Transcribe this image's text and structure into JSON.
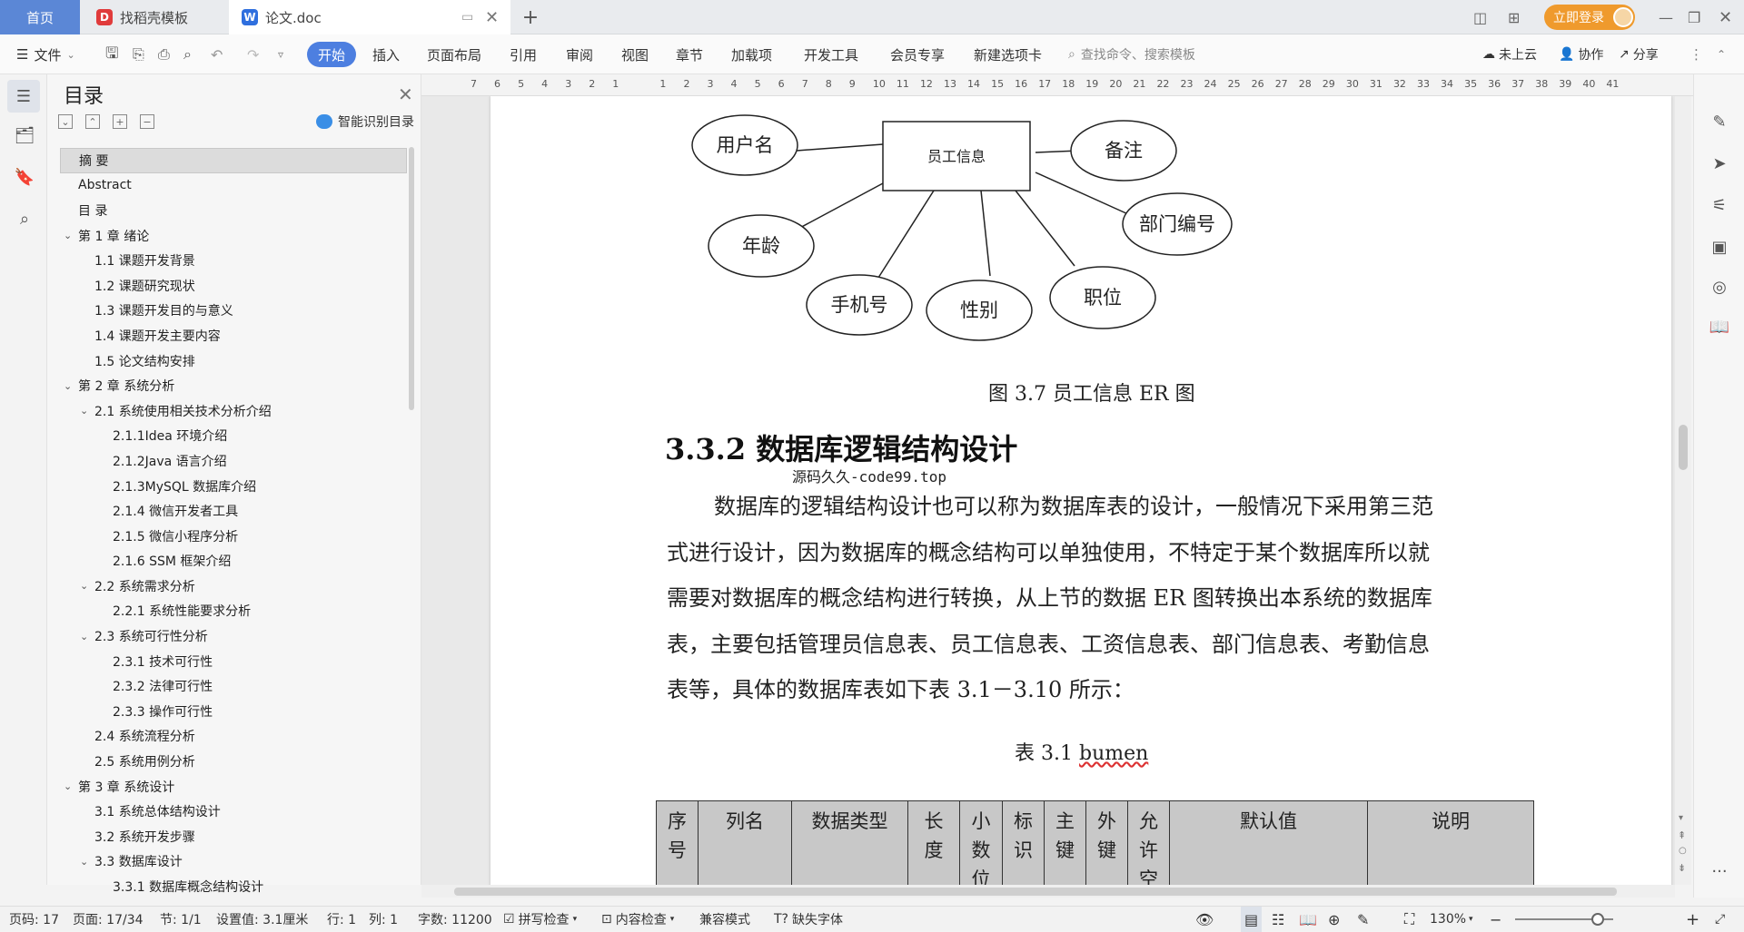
{
  "tabs": {
    "home": "首页",
    "template": "找稻壳模板",
    "doc": "论文.doc",
    "add": "+"
  },
  "titlebar": {
    "login": "立即登录"
  },
  "menu": {
    "file": "文件",
    "tabs": [
      "开始",
      "插入",
      "页面布局",
      "引用",
      "审阅",
      "视图",
      "章节",
      "加载项",
      "开发工具",
      "会员专享",
      "新建选项卡"
    ],
    "search_placeholder": "查找命令、搜索模板",
    "cloud": "未上云",
    "collab": "协作",
    "share": "分享"
  },
  "toc": {
    "title": "目录",
    "smart": "智能识别目录",
    "items": [
      {
        "label": "摘  要",
        "level": 0,
        "chevron": false,
        "selected": true
      },
      {
        "label": "Abstract",
        "level": 0,
        "chevron": false
      },
      {
        "label": "目  录",
        "level": 0,
        "chevron": false
      },
      {
        "label": "第 1 章   绪论",
        "level": 0,
        "chevron": true
      },
      {
        "label": "1.1 课题开发背景",
        "level": 1,
        "chevron": false
      },
      {
        "label": "1.2 课题研究现状",
        "level": 1,
        "chevron": false
      },
      {
        "label": "1.3 课题开发目的与意义",
        "level": 1,
        "chevron": false
      },
      {
        "label": "1.4 课题开发主要内容",
        "level": 1,
        "chevron": false
      },
      {
        "label": "1.5 论文结构安排",
        "level": 1,
        "chevron": false
      },
      {
        "label": "第 2 章  系统分析",
        "level": 0,
        "chevron": true
      },
      {
        "label": "2.1 系统使用相关技术分析介绍",
        "level": 1,
        "chevron": true
      },
      {
        "label": "2.1.1Idea 环境介绍",
        "level": 2,
        "chevron": false
      },
      {
        "label": "2.1.2Java 语言介绍",
        "level": 2,
        "chevron": false
      },
      {
        "label": " 2.1.3MySQL 数据库介绍",
        "level": 2,
        "chevron": false
      },
      {
        "label": "2.1.4 微信开发者工具",
        "level": 2,
        "chevron": false
      },
      {
        "label": "2.1.5 微信小程序分析",
        "level": 2,
        "chevron": false
      },
      {
        "label": "2.1.6 SSM 框架介绍",
        "level": 2,
        "chevron": false
      },
      {
        "label": "2.2 系统需求分析",
        "level": 1,
        "chevron": true
      },
      {
        "label": "2.2.1 系统性能要求分析",
        "level": 2,
        "chevron": false
      },
      {
        "label": "2.3 系统可行性分析",
        "level": 1,
        "chevron": true
      },
      {
        "label": "2.3.1 技术可行性",
        "level": 2,
        "chevron": false
      },
      {
        "label": "2.3.2 法律可行性",
        "level": 2,
        "chevron": false
      },
      {
        "label": "2.3.3 操作可行性",
        "level": 2,
        "chevron": false
      },
      {
        "label": "2.4 系统流程分析",
        "level": 1,
        "chevron": false
      },
      {
        "label": "2.5 系统用例分析",
        "level": 1,
        "chevron": false
      },
      {
        "label": "第 3 章  系统设计",
        "level": 0,
        "chevron": true
      },
      {
        "label": "3.1 系统总体结构设计",
        "level": 1,
        "chevron": false
      },
      {
        "label": "3.2 系统开发步骤",
        "level": 1,
        "chevron": false
      },
      {
        "label": "3.3 数据库设计",
        "level": 1,
        "chevron": true
      },
      {
        "label": "3.3.1 数据库概念结构设计",
        "level": 2,
        "chevron": false
      }
    ]
  },
  "ruler": [
    "7",
    "6",
    "5",
    "4",
    "3",
    "2",
    "1",
    "",
    "1",
    "2",
    "3",
    "4",
    "5",
    "6",
    "7",
    "8",
    "9",
    "10",
    "11",
    "12",
    "13",
    "14",
    "15",
    "16",
    "17",
    "18",
    "19",
    "20",
    "21",
    "22",
    "23",
    "24",
    "25",
    "26",
    "27",
    "28",
    "29",
    "30",
    "31",
    "32",
    "33",
    "34",
    "35",
    "36",
    "37",
    "38",
    "39",
    "40",
    "41"
  ],
  "document": {
    "er": {
      "entity": "员工信息",
      "attributes": [
        "用户名",
        "年龄",
        "手机号",
        "性别",
        "职位",
        "部门编号",
        "备注"
      ]
    },
    "figure_caption": "图 3.7 员工信息 ER 图",
    "heading": "3.3.2 数据库逻辑结构设计",
    "watermark": "源码久久-code99.top",
    "paragraph_lines": [
      "数据库的逻辑结构设计也可以称为数据库表的设计，一般情况下采用第三范",
      "式进行设计，因为数据库的概念结构可以单独使用，不特定于某个数据库所以就",
      "需要对数据库的概念结构进行转换，从上节的数据 ER 图转换出本系统的数据库",
      "表，主要包括管理员信息表、员工信息表、工资信息表、部门信息表、考勤信息",
      "表等，具体的数据库表如下表 3.1－3.10 所示："
    ],
    "table_caption_prefix": "表 3.1 ",
    "table_caption_name": "bumen",
    "table_headers": [
      "序号",
      "列名",
      "数据类型",
      "长度",
      "小数位",
      "标识",
      "主键",
      "外键",
      "允许空",
      "默认值",
      "说明"
    ]
  },
  "status": {
    "page": "页码: 17",
    "pages": "页面: 17/34",
    "section": "节: 1/1",
    "setting": "设置值: 3.1厘米",
    "row": "行: 1",
    "col": "列: 1",
    "words": "字数: 11200",
    "spell": "拼写检查",
    "content": "内容检查",
    "compat": "兼容模式",
    "missing_font": "缺失字体",
    "zoom": "130%"
  },
  "colors": {
    "accent": "#4d7fe0",
    "login": "#ef9a2d",
    "table_header": "#c8c8c8"
  }
}
